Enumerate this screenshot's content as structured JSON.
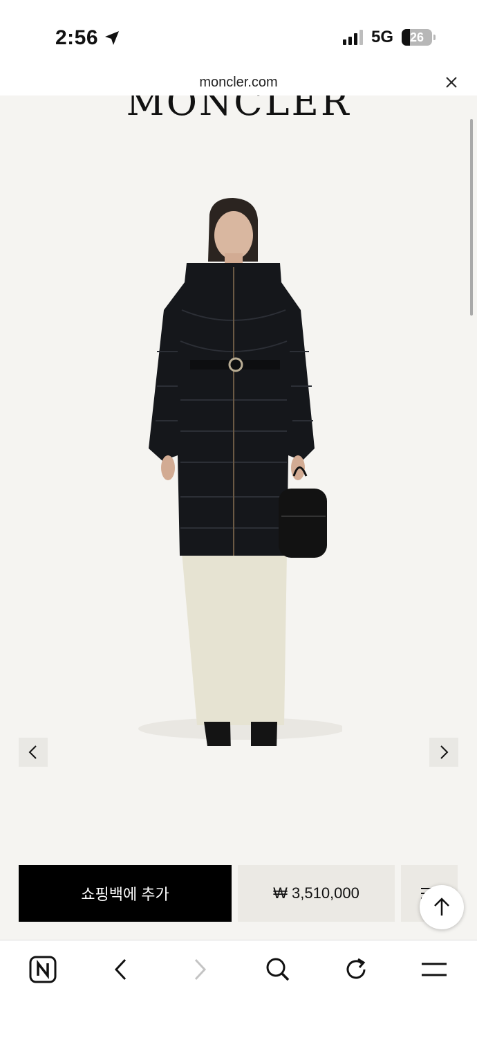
{
  "status_bar": {
    "time": "2:56",
    "network": "5G",
    "battery_level": "26"
  },
  "url_bar": {
    "domain": "moncler.com"
  },
  "page": {
    "brand_logo": "MONCLER",
    "price": "₩ 3,510,000",
    "add_to_bag_label": "쇼핑백에 추가"
  },
  "icons": {
    "location": "location-arrow-icon",
    "close": "close-icon",
    "prev": "chevron-left-icon",
    "next": "chevron-right-icon",
    "menu": "menu-lines-icon",
    "back_to_top": "arrow-up-icon",
    "naver": "naver-n-icon",
    "search": "search-icon",
    "reload": "reload-icon",
    "hamburger": "hamburger-icon"
  },
  "colors": {
    "page_background": "#f5f4f1",
    "primary_button": "#000000",
    "secondary_box": "#ebe9e4"
  }
}
